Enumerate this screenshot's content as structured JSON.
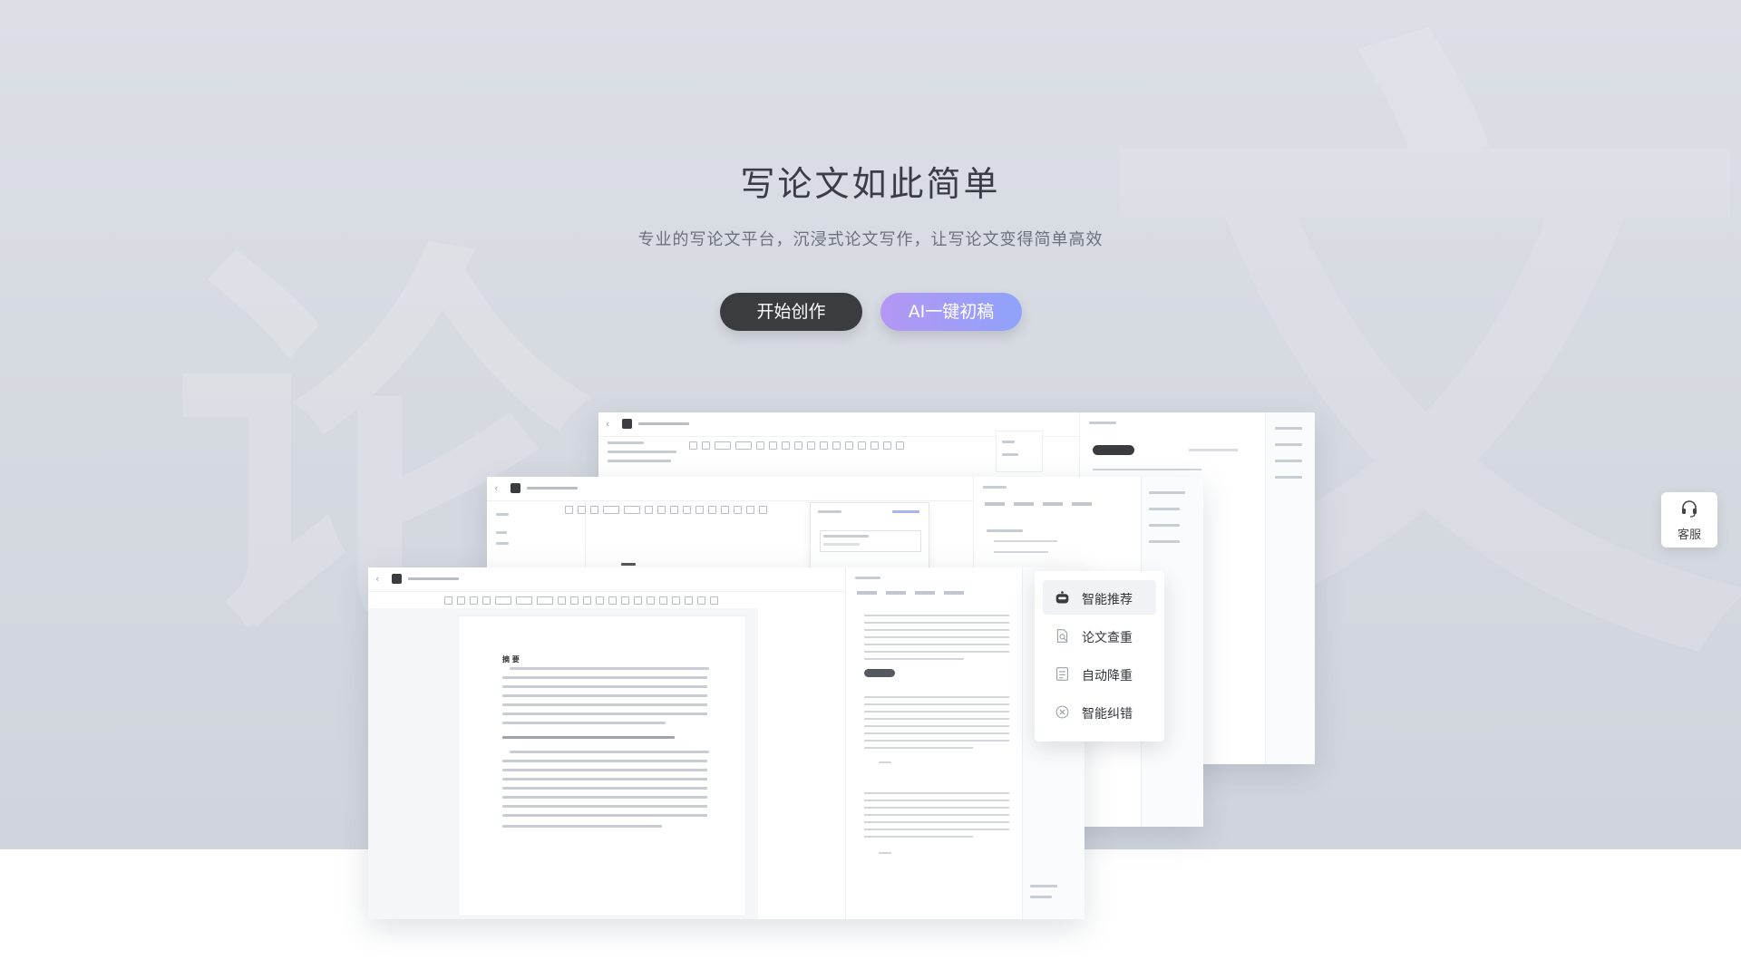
{
  "hero": {
    "title": "写论文如此简单",
    "subtitle": "专业的写论文平台，沉浸式论文写作，让写论文变得简单高效",
    "start_button": "开始创作",
    "ai_button": "AI一键初稿"
  },
  "popup_menu": {
    "items": [
      {
        "label": "智能推荐",
        "icon": "robot-icon",
        "active": true
      },
      {
        "label": "论文查重",
        "icon": "document-search-icon",
        "active": false
      },
      {
        "label": "自动降重",
        "icon": "document-list-icon",
        "active": false
      },
      {
        "label": "智能纠错",
        "icon": "error-circle-icon",
        "active": false
      }
    ]
  },
  "service": {
    "label": "客服",
    "icon": "headset-icon"
  },
  "preview": {
    "doc_heading": "摘 要",
    "colors": {
      "dark": "#3b3c3f",
      "accent_start": "#b397f3",
      "accent_end": "#8fa2fb"
    }
  }
}
